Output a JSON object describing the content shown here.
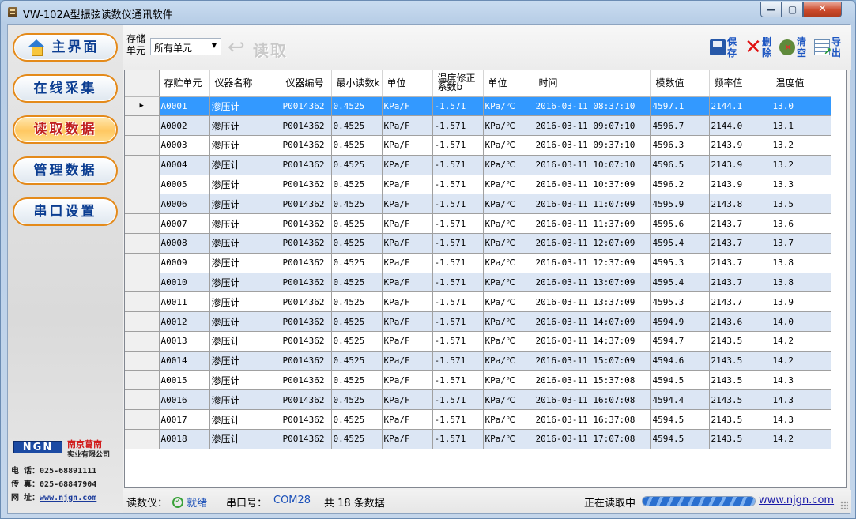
{
  "window": {
    "title": "VW-102A型振弦读数仪通讯软件",
    "controls": {
      "minimize": "—",
      "maximize": "▢",
      "close": "✕"
    }
  },
  "nav": {
    "items": [
      {
        "label": "主界面",
        "icon": "home-icon",
        "active": false
      },
      {
        "label": "在线采集",
        "active": false
      },
      {
        "label": "读取数据",
        "active": true
      },
      {
        "label": "管理数据",
        "active": false
      },
      {
        "label": "串口设置",
        "active": false
      }
    ]
  },
  "logo": {
    "brand": "NGN",
    "company_line1": "南京葛南",
    "company_line2": "实业有限公司"
  },
  "contact": {
    "phone_label": "电 话：",
    "phone": "025-68891111",
    "fax_label": "传 真：",
    "fax": "025-68847904",
    "web_label": "网 址：",
    "web": "www.njgn.com"
  },
  "toolbar": {
    "unit_label": "存储单元",
    "unit_value": "所有单元",
    "read_label": "读取",
    "save_label": "保存",
    "delete_label": "删除",
    "clear_label": "清空",
    "export_label": "导出"
  },
  "table": {
    "columns": [
      "存贮单元",
      "仪器名称",
      "仪器编号",
      "最小读数k",
      "单位",
      "温度修正系数b",
      "单位",
      "时间",
      "模数值",
      "频率值",
      "温度值"
    ],
    "selected_row": 0,
    "rows": [
      [
        "A0001",
        "渗压计",
        "P0014362",
        "0.4525",
        "KPa/F",
        "-1.571",
        "KPa/℃",
        "2016-03-11 08:37:10",
        "4597.1",
        "2144.1",
        "13.0"
      ],
      [
        "A0002",
        "渗压计",
        "P0014362",
        "0.4525",
        "KPa/F",
        "-1.571",
        "KPa/℃",
        "2016-03-11 09:07:10",
        "4596.7",
        "2144.0",
        "13.1"
      ],
      [
        "A0003",
        "渗压计",
        "P0014362",
        "0.4525",
        "KPa/F",
        "-1.571",
        "KPa/℃",
        "2016-03-11 09:37:10",
        "4596.3",
        "2143.9",
        "13.2"
      ],
      [
        "A0004",
        "渗压计",
        "P0014362",
        "0.4525",
        "KPa/F",
        "-1.571",
        "KPa/℃",
        "2016-03-11 10:07:10",
        "4596.5",
        "2143.9",
        "13.2"
      ],
      [
        "A0005",
        "渗压计",
        "P0014362",
        "0.4525",
        "KPa/F",
        "-1.571",
        "KPa/℃",
        "2016-03-11 10:37:09",
        "4596.2",
        "2143.9",
        "13.3"
      ],
      [
        "A0006",
        "渗压计",
        "P0014362",
        "0.4525",
        "KPa/F",
        "-1.571",
        "KPa/℃",
        "2016-03-11 11:07:09",
        "4595.9",
        "2143.8",
        "13.5"
      ],
      [
        "A0007",
        "渗压计",
        "P0014362",
        "0.4525",
        "KPa/F",
        "-1.571",
        "KPa/℃",
        "2016-03-11 11:37:09",
        "4595.6",
        "2143.7",
        "13.6"
      ],
      [
        "A0008",
        "渗压计",
        "P0014362",
        "0.4525",
        "KPa/F",
        "-1.571",
        "KPa/℃",
        "2016-03-11 12:07:09",
        "4595.4",
        "2143.7",
        "13.7"
      ],
      [
        "A0009",
        "渗压计",
        "P0014362",
        "0.4525",
        "KPa/F",
        "-1.571",
        "KPa/℃",
        "2016-03-11 12:37:09",
        "4595.3",
        "2143.7",
        "13.8"
      ],
      [
        "A0010",
        "渗压计",
        "P0014362",
        "0.4525",
        "KPa/F",
        "-1.571",
        "KPa/℃",
        "2016-03-11 13:07:09",
        "4595.4",
        "2143.7",
        "13.8"
      ],
      [
        "A0011",
        "渗压计",
        "P0014362",
        "0.4525",
        "KPa/F",
        "-1.571",
        "KPa/℃",
        "2016-03-11 13:37:09",
        "4595.3",
        "2143.7",
        "13.9"
      ],
      [
        "A0012",
        "渗压计",
        "P0014362",
        "0.4525",
        "KPa/F",
        "-1.571",
        "KPa/℃",
        "2016-03-11 14:07:09",
        "4594.9",
        "2143.6",
        "14.0"
      ],
      [
        "A0013",
        "渗压计",
        "P0014362",
        "0.4525",
        "KPa/F",
        "-1.571",
        "KPa/℃",
        "2016-03-11 14:37:09",
        "4594.7",
        "2143.5",
        "14.2"
      ],
      [
        "A0014",
        "渗压计",
        "P0014362",
        "0.4525",
        "KPa/F",
        "-1.571",
        "KPa/℃",
        "2016-03-11 15:07:09",
        "4594.6",
        "2143.5",
        "14.2"
      ],
      [
        "A0015",
        "渗压计",
        "P0014362",
        "0.4525",
        "KPa/F",
        "-1.571",
        "KPa/℃",
        "2016-03-11 15:37:08",
        "4594.5",
        "2143.5",
        "14.3"
      ],
      [
        "A0016",
        "渗压计",
        "P0014362",
        "0.4525",
        "KPa/F",
        "-1.571",
        "KPa/℃",
        "2016-03-11 16:07:08",
        "4594.4",
        "2143.5",
        "14.3"
      ],
      [
        "A0017",
        "渗压计",
        "P0014362",
        "0.4525",
        "KPa/F",
        "-1.571",
        "KPa/℃",
        "2016-03-11 16:37:08",
        "4594.5",
        "2143.5",
        "14.3"
      ],
      [
        "A0018",
        "渗压计",
        "P0014362",
        "0.4525",
        "KPa/F",
        "-1.571",
        "KPa/℃",
        "2016-03-11 17:07:08",
        "4594.5",
        "2143.5",
        "14.2"
      ]
    ]
  },
  "status": {
    "device_label": "读数仪：",
    "device_state": "就绪",
    "port_label": "串口号：",
    "port_value": "COM28",
    "count_text": "共 18 条数据",
    "progress_label": "正在读取中",
    "progress_fraction": 1.0,
    "website": "www.njgn.com"
  },
  "colors": {
    "selection": "#3399ff",
    "alt_row": "#dce6f4",
    "nav_border": "#e48a1a",
    "nav_text": "#0b3d91",
    "nav_active_text": "#c02020"
  }
}
